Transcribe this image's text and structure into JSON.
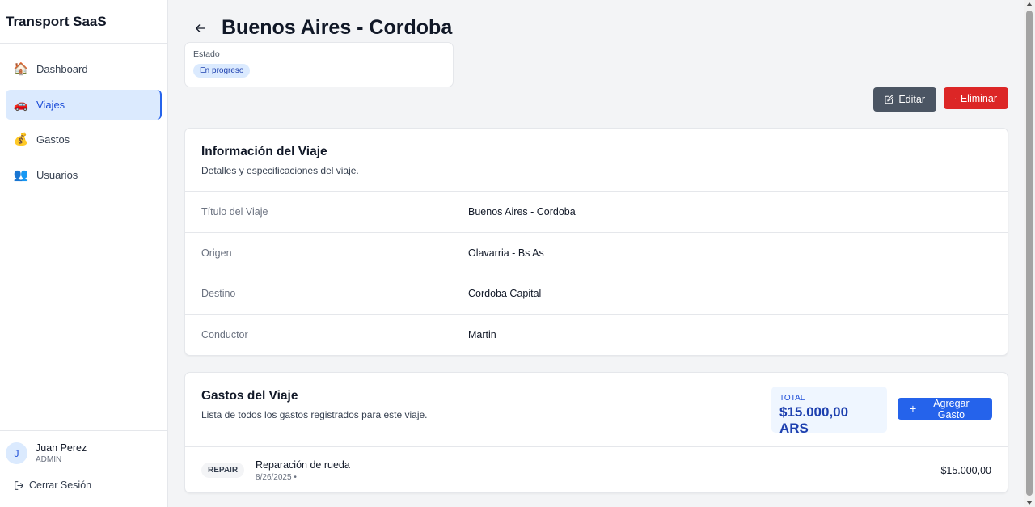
{
  "sidebar": {
    "brand": "Transport SaaS",
    "items": [
      {
        "label": "Dashboard",
        "icon": "house-icon",
        "active": false
      },
      {
        "label": "Viajes",
        "icon": "car-icon",
        "active": true
      },
      {
        "label": "Gastos",
        "icon": "money-bag-icon",
        "active": false
      },
      {
        "label": "Usuarios",
        "icon": "users-icon",
        "active": false
      }
    ],
    "user": {
      "initial": "J",
      "name": "Juan Perez",
      "role": "ADMIN"
    },
    "logout_label": "Cerrar Sesión"
  },
  "header": {
    "title": "Buenos Aires - Cordoba"
  },
  "status": {
    "label": "Estado",
    "value": "En progreso"
  },
  "actions": {
    "edit_label": "Editar",
    "delete_label": "Eliminar"
  },
  "info": {
    "title": "Información del Viaje",
    "subtitle": "Detalles y especificaciones del viaje.",
    "rows": [
      {
        "label": "Título del Viaje",
        "value": "Buenos Aires - Cordoba"
      },
      {
        "label": "Origen",
        "value": "Olavarria - Bs As"
      },
      {
        "label": "Destino",
        "value": "Cordoba Capital"
      },
      {
        "label": "Conductor",
        "value": "Martin"
      }
    ]
  },
  "expenses": {
    "title": "Gastos del Viaje",
    "subtitle": "Lista de todos los gastos registrados para este viaje.",
    "total_label": "TOTAL",
    "total_value": "$15.000,00 ARS",
    "add_label": "Agregar Gasto",
    "items": [
      {
        "type": "REPAIR",
        "title": "Reparación de rueda",
        "date": "8/26/2025 •",
        "amount": "$15.000,00"
      }
    ]
  },
  "colors": {
    "primary": "#2563eb",
    "danger": "#dc2626",
    "secondary": "#4b5563",
    "active_bg": "#dbeafe"
  }
}
